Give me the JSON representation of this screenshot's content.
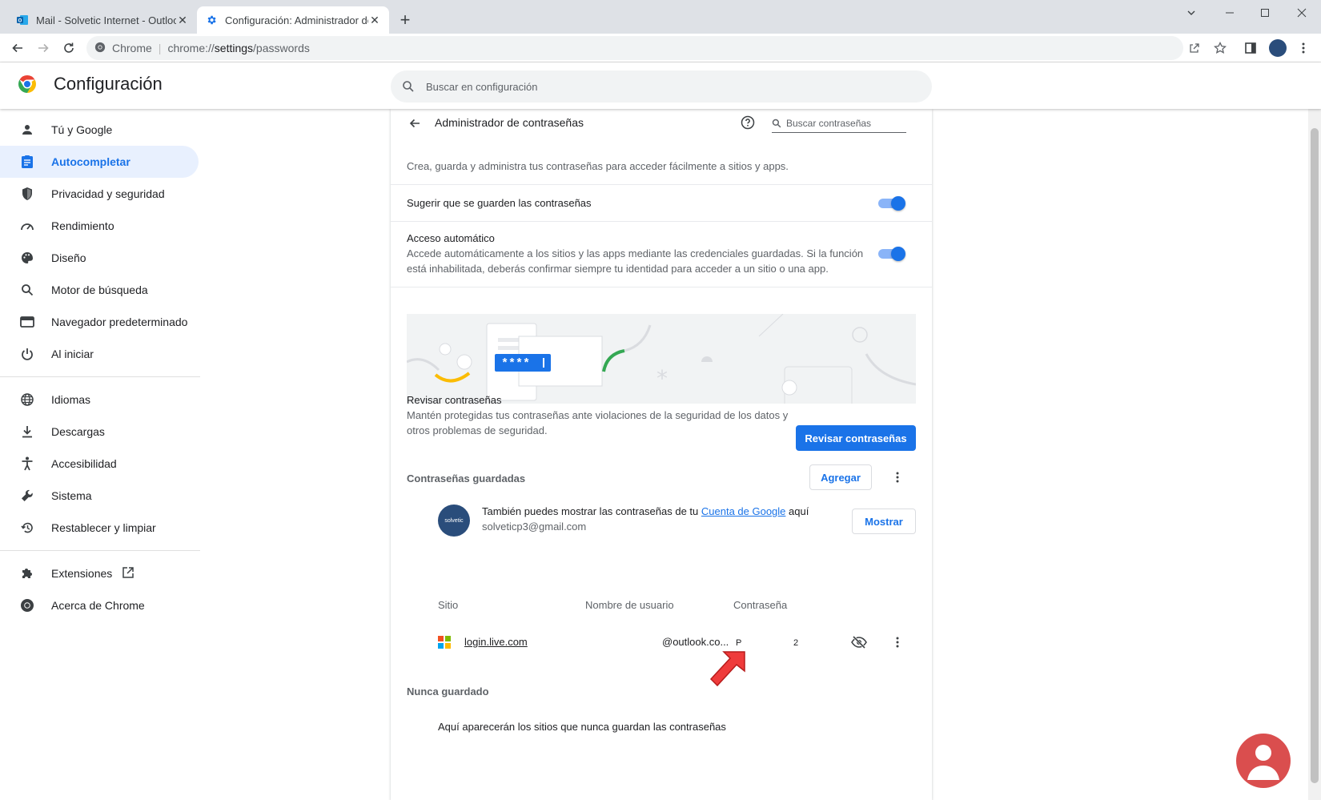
{
  "tabs": [
    {
      "title": "Mail - Solvetic Internet - Outlook",
      "icon": "outlook-icon"
    },
    {
      "title": "Configuración: Administrador de",
      "icon": "settings-gear-icon"
    }
  ],
  "address_bar": {
    "site_label": "Chrome",
    "url_prefix": "chrome://",
    "url_host": "settings",
    "url_path": "/passwords"
  },
  "header": {
    "title": "Configuración",
    "search_placeholder": "Buscar en configuración"
  },
  "sidebar": {
    "items": [
      {
        "label": "Tú y Google",
        "icon": "person-icon"
      },
      {
        "label": "Autocompletar",
        "icon": "clipboard-icon",
        "selected": true
      },
      {
        "label": "Privacidad y seguridad",
        "icon": "shield-icon"
      },
      {
        "label": "Rendimiento",
        "icon": "speedometer-icon"
      },
      {
        "label": "Diseño",
        "icon": "palette-icon"
      },
      {
        "label": "Motor de búsqueda",
        "icon": "search-icon"
      },
      {
        "label": "Navegador predeterminado",
        "icon": "browser-icon"
      },
      {
        "label": "Al iniciar",
        "icon": "power-icon"
      },
      {
        "label": "Idiomas",
        "icon": "globe-icon"
      },
      {
        "label": "Descargas",
        "icon": "download-icon"
      },
      {
        "label": "Accesibilidad",
        "icon": "accessibility-icon"
      },
      {
        "label": "Sistema",
        "icon": "wrench-icon"
      },
      {
        "label": "Restablecer y limpiar",
        "icon": "reset-icon"
      },
      {
        "label": "Extensiones",
        "icon": "puzzle-icon"
      },
      {
        "label": "Acerca de Chrome",
        "icon": "chrome-icon"
      }
    ]
  },
  "passwords": {
    "title": "Administrador de contraseñas",
    "search_placeholder": "Buscar contraseñas",
    "intro": "Crea, guarda y administra tus contraseñas para acceder fácilmente a sitios y apps.",
    "offer_save": {
      "label": "Sugerir que se guarden las contraseñas",
      "enabled": true
    },
    "auto_signin": {
      "label": "Acceso automático",
      "desc_line1": "Accede automáticamente a los sitios y las apps mediante las credenciales guardadas. Si la función",
      "desc_line2": "está inhabilitada, deberás confirmar siempre tu identidad para acceder a un sitio o una app.",
      "enabled": true
    },
    "banner_text": "****",
    "check": {
      "label": "Revisar contraseñas",
      "desc_line1": "Mantén protegidas tus contraseñas ante violaciones de la seguridad de los datos y",
      "desc_line2": "otros problemas de seguridad.",
      "button": "Revisar contraseñas"
    },
    "saved": {
      "label": "Contraseñas guardadas",
      "add_button": "Agregar",
      "account_text_before": "También puedes mostrar las contraseñas de tu ",
      "account_link": "Cuenta de Google",
      "account_text_after": " aquí",
      "account_email": "solveticp3@gmail.com",
      "account_avatar_text": "solvetic",
      "show_button": "Mostrar",
      "columns": [
        "Sitio",
        "Nombre de usuario",
        "Contraseña"
      ],
      "rows": [
        {
          "site": "login.live.com",
          "username": "@outlook.co...",
          "password_partial": "P",
          "password_tail": "2"
        }
      ]
    },
    "never": {
      "label": "Nunca guardado",
      "empty_text": "Aquí aparecerán los sitios que nunca guardan las contraseñas"
    }
  },
  "colors": {
    "accent": "#1a73e8",
    "selected_bg": "#e8f0fe",
    "arrow": "#e53935"
  }
}
